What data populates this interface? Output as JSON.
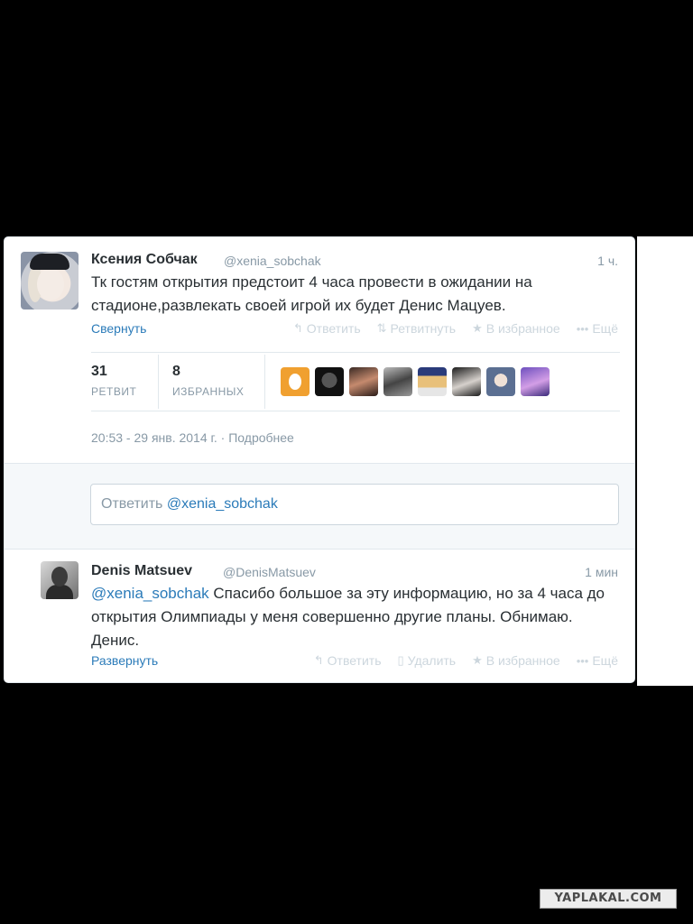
{
  "tweet1": {
    "name": "Ксения Собчак",
    "handle": "@xenia_sobchak",
    "time": "1 ч.",
    "text": "Тк гостям открытия предстоит 4 часа провести в ожидании на стадионе,развлекать своей игрой их будет Денис Мацуев.",
    "collapse": "Свернуть",
    "actions": {
      "reply": "Ответить",
      "retweet": "Ретвитнуть",
      "favorite": "В избранное",
      "more": "Ещё"
    },
    "stats": {
      "retweets": "31",
      "retweets_label": "РЕТВИТ",
      "favorites": "8",
      "favorites_label": "ИЗБРАННЫХ"
    },
    "favoriters": [
      "egg-avatar",
      "user-avatar",
      "user-avatar",
      "user-avatar",
      "user-avatar",
      "user-avatar",
      "user-avatar",
      "user-avatar"
    ],
    "date": "20:53 - 29 янв. 2014 г. · Подробнее"
  },
  "reply_box": {
    "prefix": "Ответить",
    "mention": "@xenia_sobchak"
  },
  "tweet2": {
    "name": "Denis Matsuev",
    "handle": "@DenisMatsuev",
    "time": "1 мин",
    "mention": "@xenia_sobchak",
    "text": " Спасибо большое за эту информацию, но за 4 часа до открытия Олимпиады у меня совершенно другие планы. Обнимаю. Денис.",
    "expand": "Развернуть",
    "actions": {
      "reply": "Ответить",
      "delete": "Удалить",
      "favorite": "В избранное",
      "more": "Ещё"
    }
  },
  "watermark": "YAPLAKAL.COM",
  "colors": {
    "link": "#2b7bb9",
    "muted": "#8899a6",
    "text": "#292f33",
    "background": "#000000"
  }
}
